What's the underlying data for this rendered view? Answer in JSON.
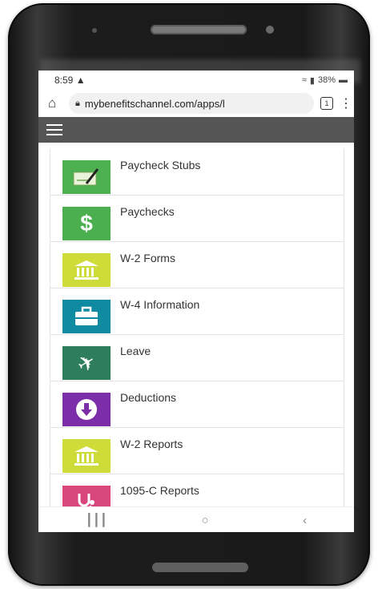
{
  "status": {
    "time": "8:59",
    "battery": "38%"
  },
  "browser": {
    "url": "mybenefitschannel.com/apps/l",
    "tab_count": "1"
  },
  "menu_items": [
    {
      "label": "Paycheck Stubs",
      "icon": "check-pen-icon",
      "color": "#4caf50"
    },
    {
      "label": "Paychecks",
      "icon": "dollar-icon",
      "color": "#4bae4f"
    },
    {
      "label": "W-2 Forms",
      "icon": "bank-icon",
      "color": "#cddc39"
    },
    {
      "label": "W-4 Information",
      "icon": "briefcase-icon",
      "color": "#0f8aa1"
    },
    {
      "label": "Leave",
      "icon": "airplane-icon",
      "color": "#2e7d5b"
    },
    {
      "label": "Deductions",
      "icon": "download-circle-icon",
      "color": "#7b2ea8"
    },
    {
      "label": "W-2 Reports",
      "icon": "bank-icon",
      "color": "#cddc39"
    },
    {
      "label": "1095-C Reports",
      "icon": "stethoscope-icon",
      "color": "#d9467b"
    }
  ]
}
